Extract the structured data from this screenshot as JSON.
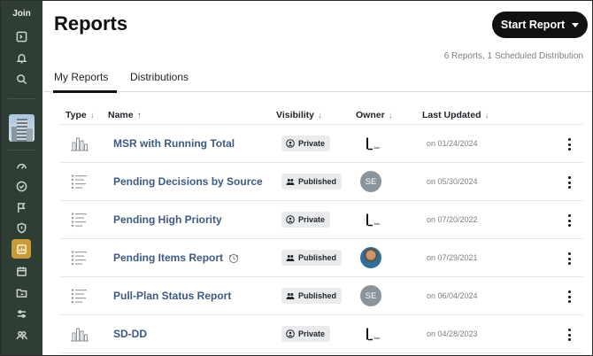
{
  "sidebar": {
    "brand": "Join",
    "active_item": "reports"
  },
  "header": {
    "title": "Reports",
    "start_button": "Start Report",
    "summary": "6 Reports, 1 Scheduled Distribution"
  },
  "tabs": [
    {
      "label": "My Reports",
      "active": true
    },
    {
      "label": "Distributions",
      "active": false
    }
  ],
  "columns": {
    "type": "Type",
    "name": "Name",
    "visibility": "Visibility",
    "owner": "Owner",
    "last_updated": "Last Updated"
  },
  "rows": [
    {
      "type": "bar-chart",
      "name": "MSR with Running Total",
      "scheduled": false,
      "visibility": "Private",
      "owner": "logo",
      "updated": "on 01/24/2024"
    },
    {
      "type": "list",
      "name": "Pending Decisions by Source",
      "scheduled": false,
      "visibility": "Published",
      "owner": "SE",
      "updated": "on 05/30/2024"
    },
    {
      "type": "list",
      "name": "Pending High Priority",
      "scheduled": false,
      "visibility": "Private",
      "owner": "logo",
      "updated": "on 07/20/2022"
    },
    {
      "type": "list",
      "name": "Pending Items Report",
      "scheduled": true,
      "visibility": "Published",
      "owner": "photo",
      "updated": "on 07/29/2021"
    },
    {
      "type": "list",
      "name": "Pull-Plan Status Report",
      "scheduled": false,
      "visibility": "Published",
      "owner": "SE",
      "updated": "on 06/04/2024"
    },
    {
      "type": "bar-chart",
      "name": "SD-DD",
      "scheduled": false,
      "visibility": "Private",
      "owner": "logo",
      "updated": "on 04/28/2023"
    }
  ],
  "colors": {
    "sidebar_bg": "#2f3e35",
    "active_accent": "#c79a3a",
    "link": "#3d5a80"
  }
}
